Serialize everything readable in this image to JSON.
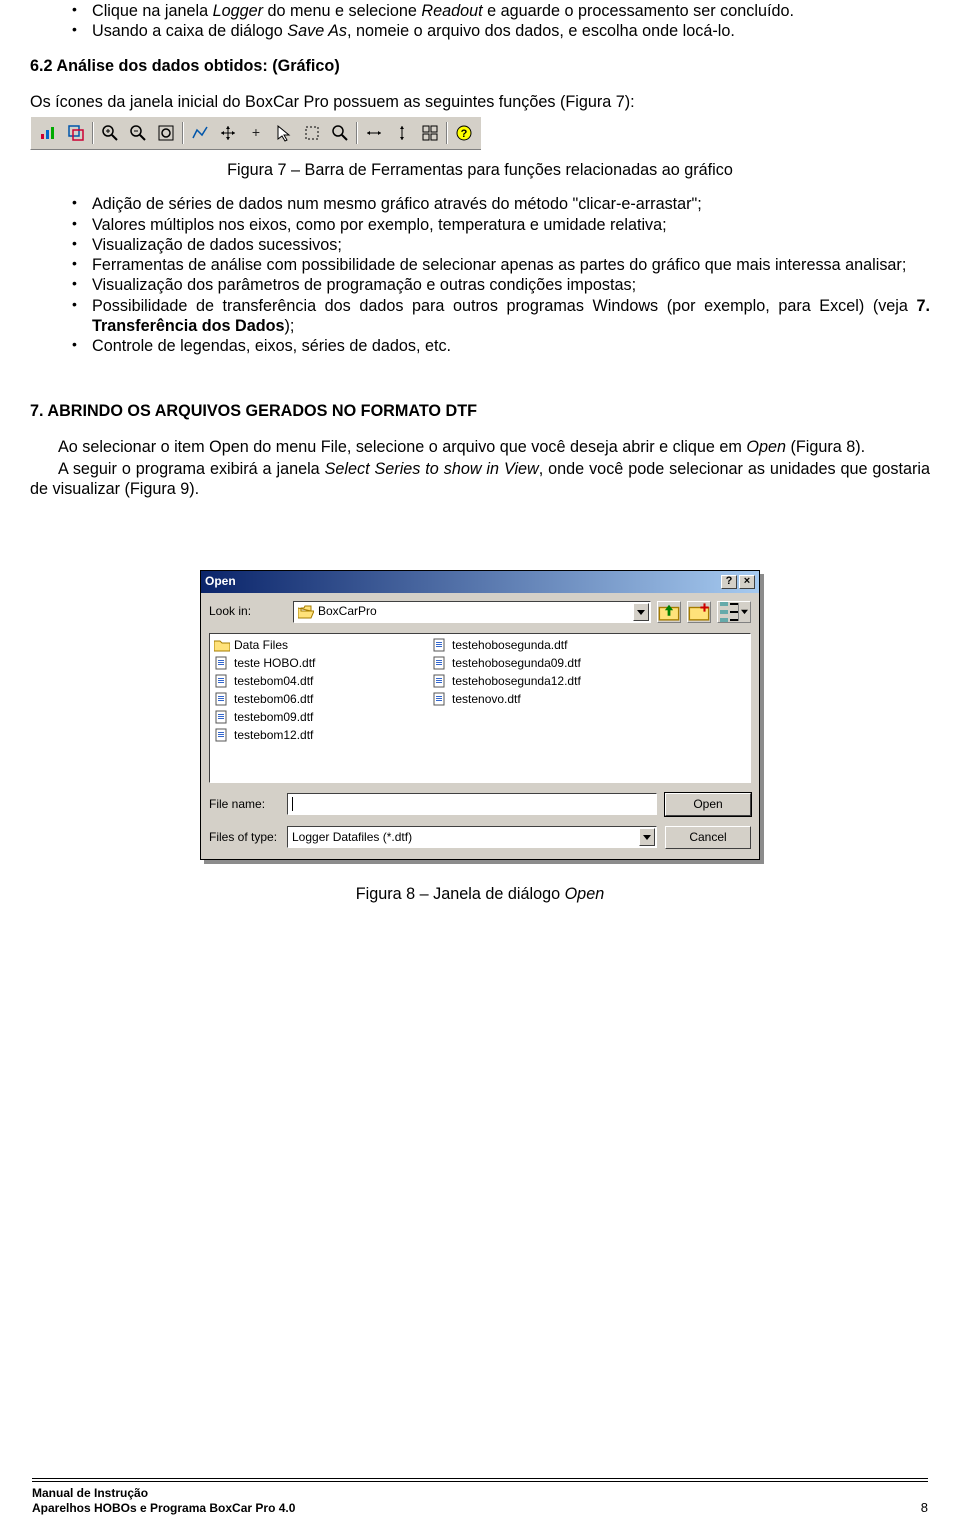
{
  "list1": {
    "i0a": "Clique na janela ",
    "i0b": "Logger",
    "i0c": " do menu e selecione ",
    "i0d": "Readout",
    "i0e": " e aguarde o processamento ser concluído.",
    "i1a": "Usando a caixa de diálogo ",
    "i1b": "Save As",
    "i1c": ", nomeie o arquivo dos dados, e escolha onde locá-lo."
  },
  "sec62": "6.2 Análise dos dados obtidos: (Gráfico)",
  "p1": "Os  ícones da janela inicial do BoxCar Pro possuem as seguintes funções (Figura 7):",
  "fig7cap": "Figura 7 – Barra de Ferramentas para funções relacionadas ao gráfico",
  "list2": {
    "i0": "Adição de séries de dados num mesmo gráfico através do método \"clicar-e-arrastar\";",
    "i1": "Valores múltiplos nos eixos, como por exemplo, temperatura e umidade relativa;",
    "i2": "Visualização de dados sucessivos;",
    "i3": "Ferramentas de análise com possibilidade de selecionar apenas as partes do gráfico que mais interessa analisar;",
    "i4": "Visualização dos parâmetros de programação e outras condições impostas;",
    "i5a": "Possibilidade de transferência dos dados para outros programas Windows (por exemplo, para Excel) (veja ",
    "i5b": "7. Transferência dos Dados",
    "i5c": ");",
    "i6": "Controle de legendas, eixos, séries de dados, etc."
  },
  "sec7": "7. ABRINDO OS ARQUIVOS GERADOS NO FORMATO DTF",
  "p2a": "Ao selecionar o item Open do menu File, selecione o arquivo que você deseja abrir e clique em ",
  "p2b": "Open",
  "p2c": " (Figura 8).",
  "p3a": "A seguir o programa exibirá a janela ",
  "p3b": "Select Series to show in View",
  "p3c": ", onde você pode selecionar as unidades que gostaria de visualizar (Figura 9).",
  "dialog": {
    "title": "Open",
    "lookin_label": "Look in:",
    "lookin_value": "BoxCarPro",
    "col1": [
      "Data Files",
      "teste HOBO.dtf",
      "testebom04.dtf",
      "testebom06.dtf",
      "testebom09.dtf",
      "testebom12.dtf"
    ],
    "col2": [
      "testehobosegunda.dtf",
      "testehobosegunda09.dtf",
      "testehobosegunda12.dtf",
      "testenovo.dtf"
    ],
    "filename_label": "File name:",
    "filename_value": "",
    "filetype_label": "Files of type:",
    "filetype_value": "Logger Datafiles (*.dtf)",
    "open_btn": "Open",
    "cancel_btn": "Cancel"
  },
  "fig8cap": "Figura 8 – Janela de diálogo ",
  "fig8cap_i": "Open",
  "footer": {
    "line1": "Manual de Instrução",
    "line2": "Aparelhos HOBOs e Programa BoxCar Pro 4.0",
    "page": "8"
  }
}
